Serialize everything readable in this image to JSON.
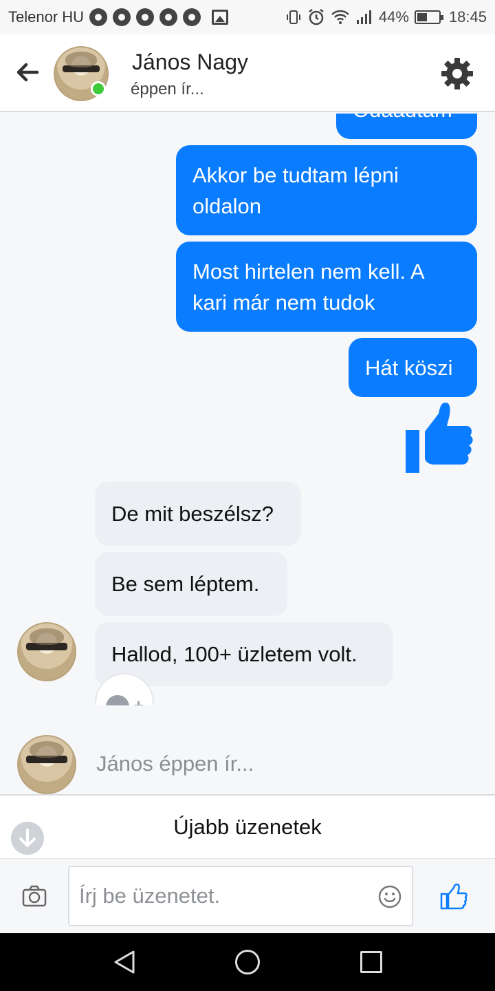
{
  "status_bar": {
    "carrier": "Telenor HU",
    "battery": "44%",
    "time": "18:45",
    "icons": [
      "chrome-icon",
      "chrome-icon",
      "chrome-icon",
      "chrome-icon",
      "chrome-icon",
      "image-icon",
      "vibrate-icon",
      "alarm-icon",
      "wifi-icon",
      "signal-icon",
      "battery-icon"
    ]
  },
  "header": {
    "name": "János Nagy",
    "status": "éppen ír...",
    "online": true,
    "online_color": "#3ecb3a"
  },
  "messages": [
    {
      "from": "me",
      "text": "Odaadtam"
    },
    {
      "from": "me",
      "text": "Akkor be tudtam lépni oldalon"
    },
    {
      "from": "me",
      "text": "Most hirtelen nem kell. A kari már nem tudok"
    },
    {
      "from": "me",
      "text": "Hát köszi"
    },
    {
      "from": "me",
      "sticker": "thumbs-up-icon"
    },
    {
      "from": "them",
      "text": "De mit beszélsz?"
    },
    {
      "from": "them",
      "text": "Be sem léptem."
    },
    {
      "from": "them",
      "text": "Hallod, 100+ üzletem volt."
    }
  ],
  "typing_indicator": "János éppen ír...",
  "new_messages_label": "Újabb üzenetek",
  "composer": {
    "placeholder": "Írj be üzenetet."
  },
  "colors": {
    "accent": "#0a7cff",
    "incoming_bubble": "#eceff3"
  }
}
